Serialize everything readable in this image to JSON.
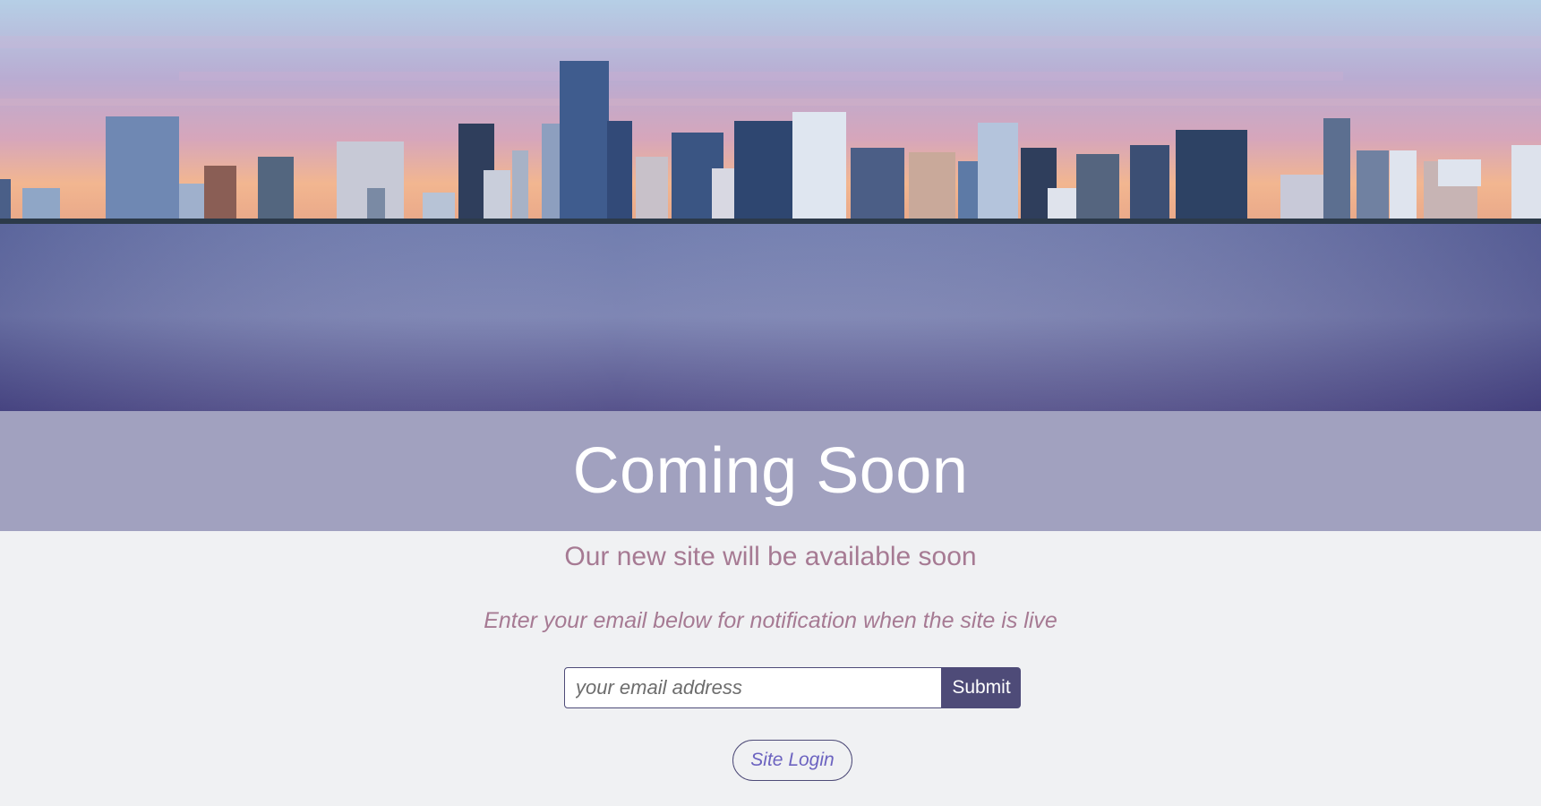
{
  "hero": {
    "image_description": "city-skyline-over-water",
    "colors": {
      "sky_top": "#b7cde3",
      "sky_mid": "#b8a8cc",
      "sky_glow": "#f2b48e",
      "water_top": "#6f78a8",
      "water_bottom": "#4a4880",
      "building_dark": "#3f557c",
      "building_light": "#9fb4cf"
    }
  },
  "title": "Coming Soon",
  "subtitle": "Our new site will be available soon",
  "prompt": "Enter your email below for notification when the site is live",
  "signup": {
    "email_placeholder": "your email address",
    "submit_label": "Submit"
  },
  "login": {
    "label": "Site Login"
  },
  "colors": {
    "title_band": "#a1a1bf",
    "page_bg": "#f0f1f3",
    "accent_text": "#a67a93",
    "button_bg": "#4e4b78",
    "login_text": "#6c63c0"
  }
}
